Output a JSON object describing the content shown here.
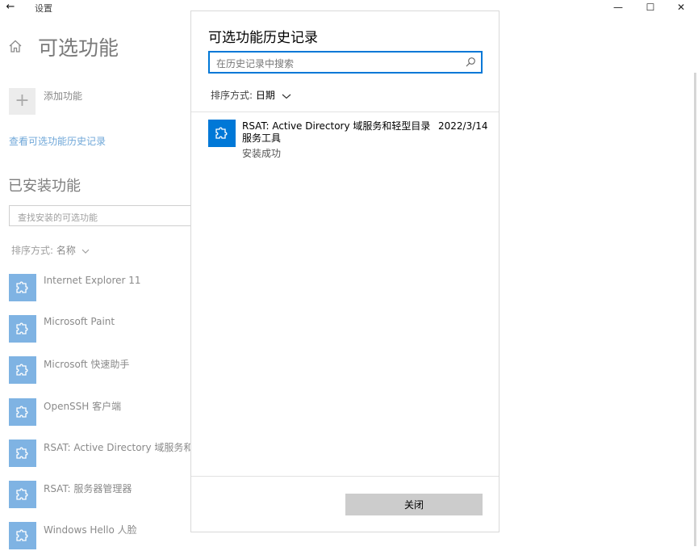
{
  "window": {
    "title": "设置",
    "back_icon": "←",
    "minimize_icon": "—",
    "maximize_icon": "☐",
    "close_icon": "✕"
  },
  "settings_page": {
    "title": "可选功能",
    "add_feature_icon": "+",
    "add_feature_label": "添加功能",
    "history_link": "查看可选功能历史记录",
    "installed_title": "已安装功能",
    "search_placeholder": "查找安装的可选功能",
    "sort_label": "排序方式:",
    "sort_value": "名称",
    "installed_features": [
      "Internet Explorer 11",
      "Microsoft Paint",
      "Microsoft 快速助手",
      "OpenSSH 客户端",
      "RSAT: Active Directory 域服务和轻型目录服务工具",
      "RSAT: 服务器管理器",
      "Windows Hello 人脸"
    ]
  },
  "dialog": {
    "title": "可选功能历史记录",
    "search_placeholder": "在历史记录中搜索",
    "sort_label": "排序方式:",
    "sort_value": "日期",
    "history": [
      {
        "name": "RSAT: Active Directory 域服务和轻型目录服务工具",
        "date": "2022/3/14",
        "status": "安装成功"
      }
    ],
    "close_button": "关闭"
  },
  "colors": {
    "accent": "#0078d7",
    "accent_dim": "#7fb3e3",
    "link_dim": "#6fa7d8",
    "button_bg": "#cccccc"
  }
}
